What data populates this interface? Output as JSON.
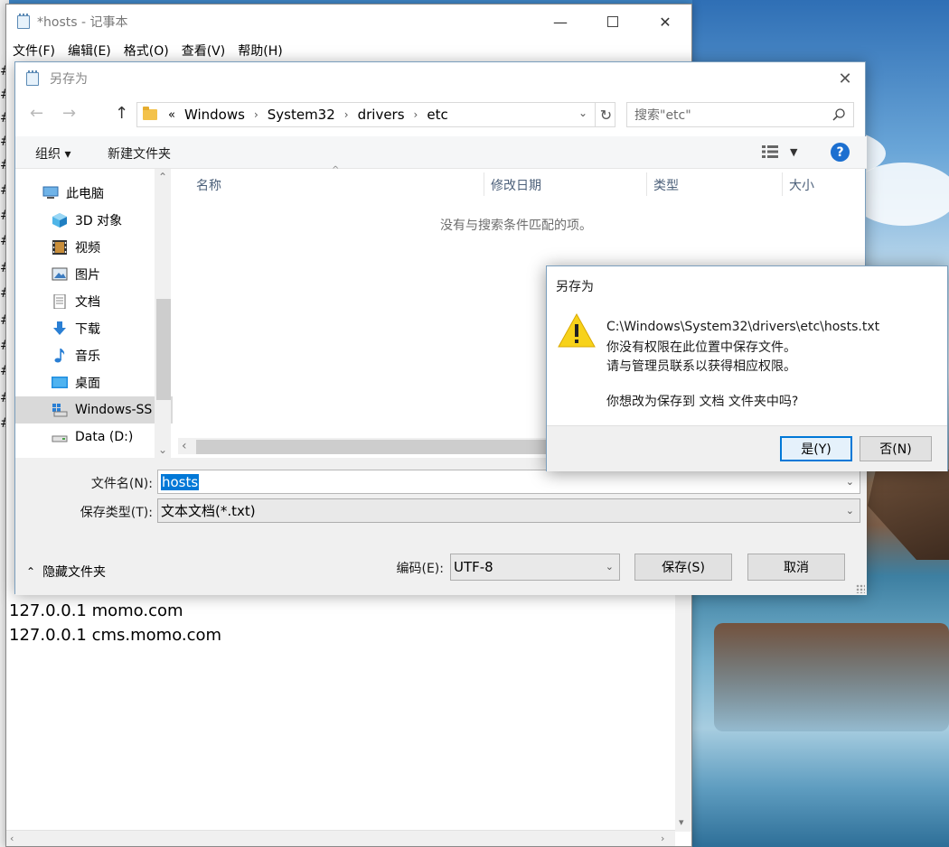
{
  "notepad": {
    "title": "*hosts - 记事本",
    "menu": [
      "文件(F)",
      "编辑(E)",
      "格式(O)",
      "查看(V)",
      "帮助(H)"
    ],
    "lines": [
      "127.0.0.1 momo.com",
      "127.0.0.1 cms.momo.com"
    ],
    "left_marks": [
      "#",
      "#",
      "#",
      "#",
      "#",
      "#",
      "#",
      "#",
      "#",
      "#",
      "#",
      "#",
      "#",
      "#",
      "#"
    ]
  },
  "saveas": {
    "title": "另存为",
    "breadcrumb": {
      "prefix": "«",
      "parts": [
        "Windows",
        "System32",
        "drivers",
        "etc"
      ]
    },
    "search_placeholder": "搜索\"etc\"",
    "toolbar": {
      "organize": "组织 ▾",
      "new_folder": "新建文件夹"
    },
    "tree": [
      {
        "label": "此电脑",
        "icon": "computer-icon"
      },
      {
        "label": "3D 对象",
        "icon": "cube-icon"
      },
      {
        "label": "视频",
        "icon": "film-icon"
      },
      {
        "label": "图片",
        "icon": "picture-icon"
      },
      {
        "label": "文档",
        "icon": "document-icon"
      },
      {
        "label": "下载",
        "icon": "download-icon"
      },
      {
        "label": "音乐",
        "icon": "music-icon"
      },
      {
        "label": "桌面",
        "icon": "desktop-icon"
      },
      {
        "label": "Windows-SS",
        "icon": "windows-drive-icon"
      },
      {
        "label": "Data (D:)",
        "icon": "drive-icon"
      }
    ],
    "columns": [
      "名称",
      "修改日期",
      "类型",
      "大小"
    ],
    "empty_message": "没有与搜索条件匹配的项。",
    "filename_label": "文件名(N):",
    "filename_value": "hosts",
    "filetype_label": "保存类型(T):",
    "filetype_value": "文本文档(*.txt)",
    "encoding_label": "编码(E):",
    "encoding_value": "UTF-8",
    "hide_folders": "隐藏文件夹",
    "save": "保存(S)",
    "cancel": "取消"
  },
  "warning": {
    "title": "另存为",
    "lines": [
      "C:\\Windows\\System32\\drivers\\etc\\hosts.txt",
      "你没有权限在此位置中保存文件。",
      "请与管理员联系以获得相应权限。",
      "你想改为保存到 文档 文件夹中吗?"
    ],
    "yes": "是(Y)",
    "no": "否(N)"
  },
  "colors": {
    "accent": "#0078d7",
    "warning": "#f7d21a",
    "help": "#1c6fd0"
  }
}
